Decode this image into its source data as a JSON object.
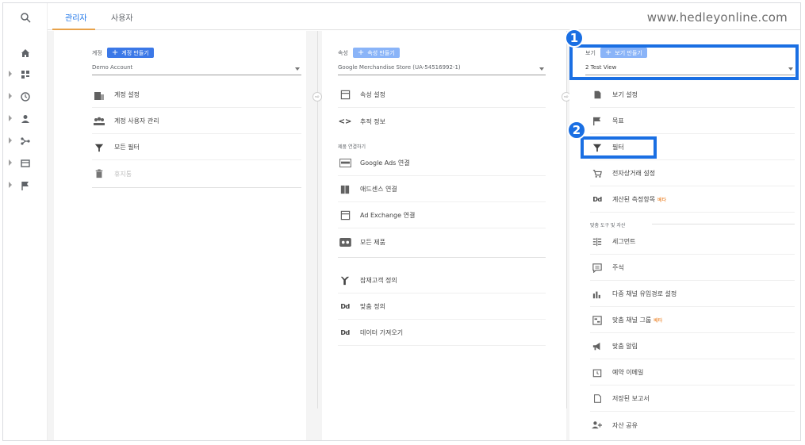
{
  "tabs": [
    "관리자",
    "사용자"
  ],
  "watermark": "www.hedleyonline.com",
  "account": {
    "label": "계정",
    "create_label": "계정 만들기",
    "selected": "Demo Account",
    "items": [
      "계정 설정",
      "계정 사용자 관리",
      "모든 필터",
      "휴지통"
    ]
  },
  "property": {
    "label": "속성",
    "create_label": "속성 만들기",
    "selected": "Google Merchandise Store (UA-54516992-1)",
    "items": [
      "속성 설정",
      "추적 정보"
    ],
    "section_label": "제품 연결하기",
    "product_links": [
      "Google Ads 연결",
      "애드센스 연결",
      "Ad Exchange 연결",
      "모든 제품"
    ],
    "items2": [
      "잠재고객 정의",
      "맞춤 정의",
      "데이터 가져오기"
    ]
  },
  "view": {
    "label": "보기",
    "create_label": "보기 만들기",
    "selected": "2 Test View",
    "items": [
      "보기 설정",
      "목표",
      "필터",
      "전자상거래 설정",
      "계산된 측정항목"
    ],
    "beta_label": "베타",
    "section_label": "맞춤 도구 및 자산",
    "tools": [
      "세그먼트",
      "주석",
      "다중 채널 유입경로 설정",
      "맞춤 채널 그룹",
      "맞춤 알림",
      "예약 이메일",
      "저장된 보고서",
      "자산 공유"
    ]
  },
  "annotations": [
    "1",
    "2"
  ],
  "colors": {
    "accent": "#1a73e8",
    "annotation": "#1a6fe3",
    "beta": "#e8710a"
  }
}
